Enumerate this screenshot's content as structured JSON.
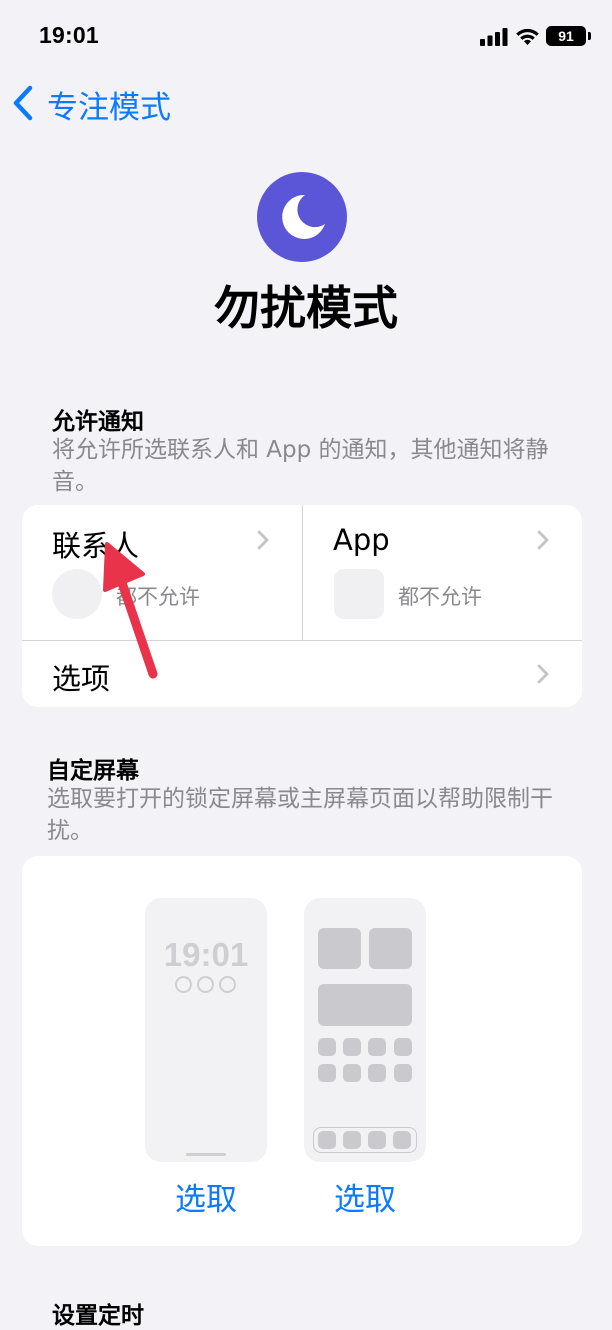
{
  "status_bar": {
    "time": "19:01",
    "battery": "91"
  },
  "nav": {
    "back_label": "专注模式"
  },
  "hero": {
    "title": "勿扰模式",
    "accent_color": "#5b56d8",
    "icon": "moon-icon"
  },
  "allow_notifications": {
    "header": "允许通知",
    "description": "将允许所选联系人和 App 的通知，其他通知将静音。",
    "people": {
      "label": "联系人",
      "status": "都不允许"
    },
    "apps": {
      "label": "App",
      "status": "都不允许"
    },
    "options_label": "选项"
  },
  "customize_screens": {
    "header": "自定屏幕",
    "description": "选取要打开的锁定屏幕或主屏幕页面以帮助限制干扰。",
    "lock_screen_time": "19:01",
    "lock_select": "选取",
    "home_select": "选取"
  },
  "next_section_header": "设置定时",
  "colors": {
    "link": "#0a7aff",
    "annotation_arrow": "#e8334a"
  }
}
